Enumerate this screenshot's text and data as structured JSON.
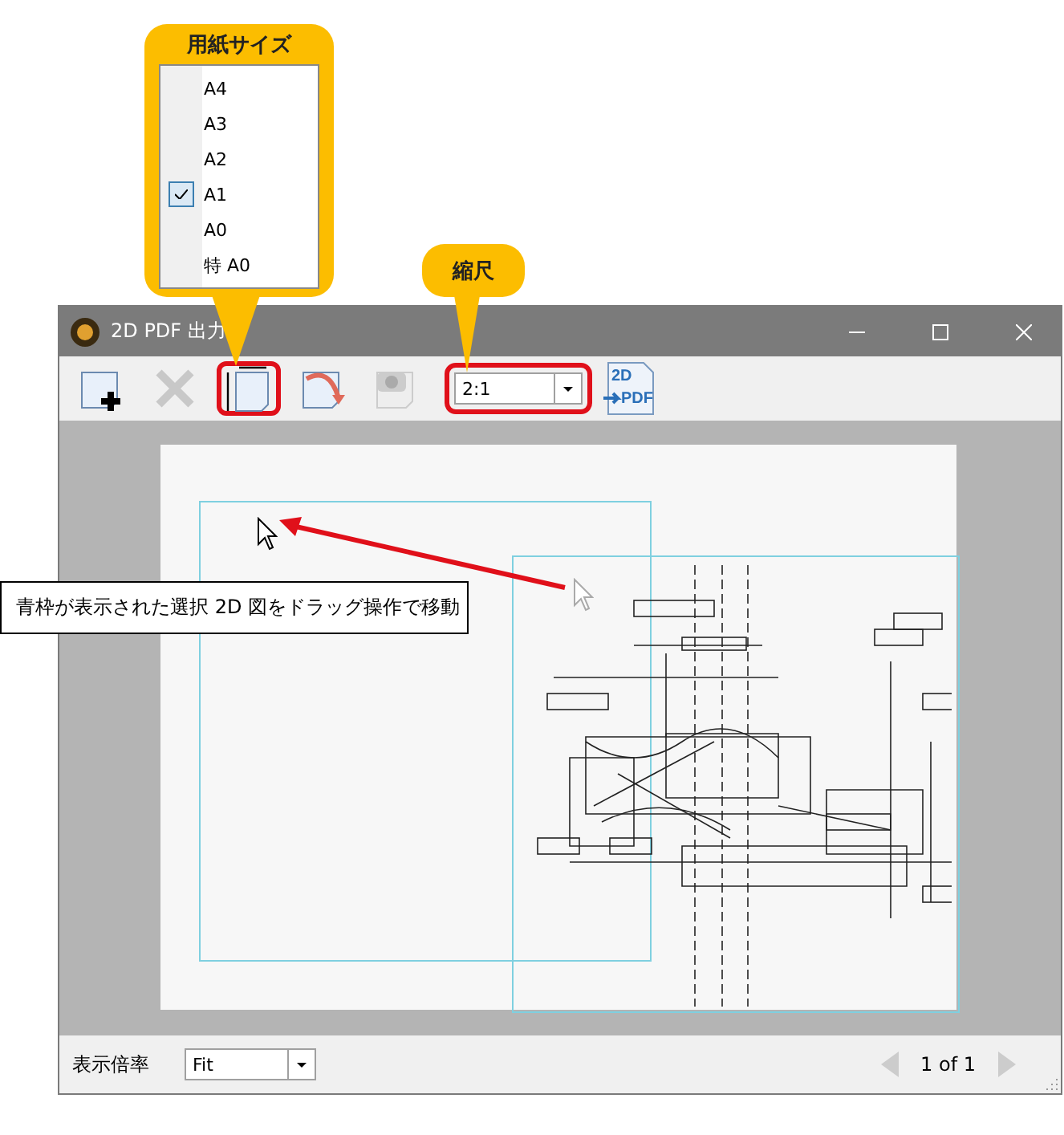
{
  "paper_callout": {
    "title": "用紙サイズ",
    "items": [
      {
        "label": "A4",
        "checked": false
      },
      {
        "label": "A3",
        "checked": false
      },
      {
        "label": "A2",
        "checked": false
      },
      {
        "label": "A1",
        "checked": true
      },
      {
        "label": "A0",
        "checked": false
      },
      {
        "label": "特 A0",
        "checked": false
      }
    ]
  },
  "scale_callout": {
    "title": "縮尺"
  },
  "window": {
    "title": "2D PDF 出力"
  },
  "toolbar": {
    "buttons": [
      {
        "kind": "add",
        "disabled": false,
        "highlighted": false
      },
      {
        "kind": "delete",
        "disabled": true,
        "highlighted": false
      },
      {
        "kind": "paper",
        "disabled": false,
        "highlighted": true
      },
      {
        "kind": "rotate",
        "disabled": false,
        "highlighted": false
      },
      {
        "kind": "camera",
        "disabled": true,
        "highlighted": false
      }
    ],
    "scale": {
      "value": "2:1",
      "highlighted": true
    },
    "pdf_button": {
      "label_top": "2D",
      "label_bottom": "PDF"
    }
  },
  "hint": "青枠が表示された選択 2D 図をドラッグ操作で移動",
  "footer": {
    "zoom_label": "表示倍率",
    "zoom_value": "Fit",
    "page": "1 of 1"
  }
}
